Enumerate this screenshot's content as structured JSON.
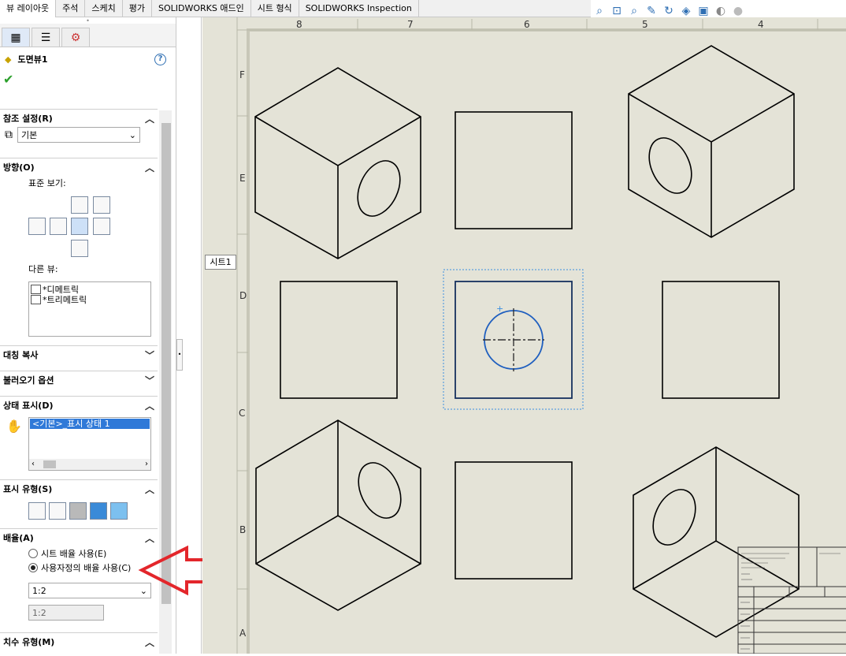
{
  "tabs": [
    "뷰 레이아웃",
    "주석",
    "스케치",
    "평가",
    "SOLIDWORKS 애드인",
    "시트 형식",
    "SOLIDWORKS Inspection"
  ],
  "view_tools": [
    "zoom-to-fit-icon",
    "zoom-area-icon",
    "previous-view-icon",
    "section-view-icon",
    "rotate-icon",
    "display-style-icon",
    "view-orientation-icon",
    "hide-show-icon",
    "appearance-icon"
  ],
  "panel": {
    "title": "도면뷰1",
    "reference": {
      "header": "참조 설정(R)",
      "value": "기본"
    },
    "orientation": {
      "header": "방향(O)",
      "standard_label": "표준 보기:",
      "other_label": "다른 뷰:",
      "other_views": [
        "*디메트릭",
        "*트리메트릭"
      ]
    },
    "mirror": {
      "header": "대칭 복사"
    },
    "import": {
      "header": "불러오기 옵션"
    },
    "display_state": {
      "header": "상태 표시(D)",
      "item": "<기본>_표시 상태 1"
    },
    "display_style": {
      "header": "표시 유형(S)"
    },
    "scale": {
      "header": "배율(A)",
      "option1": "시트 배율 사용(E)",
      "option2": "사용자정의 배율 사용(C)",
      "selected": 2,
      "value": "1:2",
      "custom": "1:2"
    },
    "dimension": {
      "header": "치수 유형(M)"
    }
  },
  "sheet": {
    "tooltip": "시트1",
    "top_zones": [
      "8",
      "7",
      "6",
      "5",
      "4"
    ],
    "left_zones": [
      "F",
      "E",
      "D",
      "C",
      "B",
      "A"
    ]
  },
  "colors": {
    "arrow": "#e3262b",
    "selection": "#1f5fbf",
    "sheet_bg": "#e4e3d7"
  }
}
